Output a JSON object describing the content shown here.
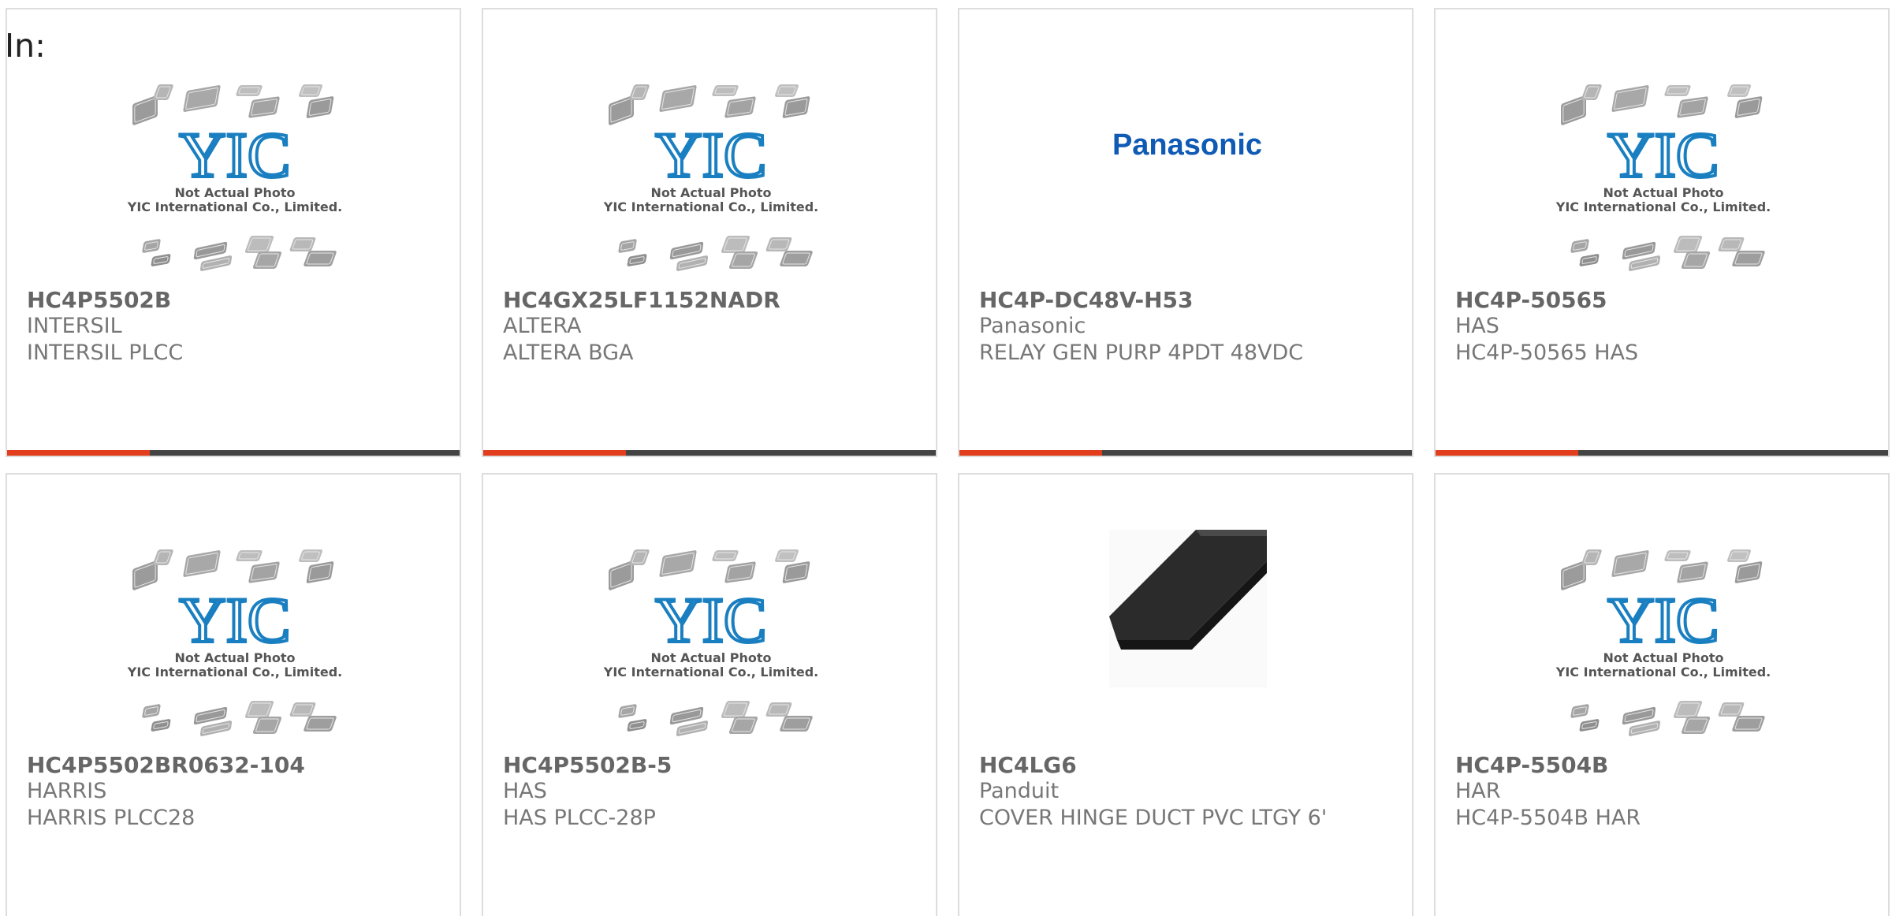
{
  "header": {
    "label": "In:"
  },
  "colors": {
    "accent": "#e23d1c",
    "bar_dark": "#444444",
    "yic_blue": "#1a7fc1",
    "panasonic_blue": "#0f5ab4"
  },
  "placeholder_image": {
    "brand": "YIC",
    "line1": "Not Actual Photo",
    "line2": "YIC International Co., Limited."
  },
  "products": [
    {
      "part_number": "HC4P5502B",
      "manufacturer": "INTERSIL",
      "description": "INTERSIL PLCC",
      "image": "yic-placeholder",
      "progress": 0.315
    },
    {
      "part_number": "HC4GX25LF1152NADR",
      "manufacturer": "ALTERA",
      "description": "ALTERA BGA",
      "image": "yic-placeholder",
      "progress": 0.315
    },
    {
      "part_number": "HC4P-DC48V-H53",
      "manufacturer": "Panasonic",
      "description": "RELAY GEN PURP 4PDT 48VDC",
      "image": "panasonic-logo",
      "logo_text": "Panasonic",
      "progress": 0.315
    },
    {
      "part_number": "HC4P-50565",
      "manufacturer": "HAS",
      "description": "HC4P-50565 HAS",
      "image": "yic-placeholder",
      "progress": 0.315
    },
    {
      "part_number": "HC4P5502BR0632-104",
      "manufacturer": "HARRIS",
      "description": "HARRIS PLCC28",
      "image": "yic-placeholder"
    },
    {
      "part_number": "HC4P5502B-5",
      "manufacturer": "HAS",
      "description": "HAS PLCC-28P",
      "image": "yic-placeholder"
    },
    {
      "part_number": "HC4LG6",
      "manufacturer": "Panduit",
      "description": "COVER HINGE DUCT PVC LTGY 6'",
      "image": "duct-cover-photo"
    },
    {
      "part_number": "HC4P-5504B",
      "manufacturer": "HAR",
      "description": "HC4P-5504B HAR",
      "image": "yic-placeholder"
    }
  ]
}
